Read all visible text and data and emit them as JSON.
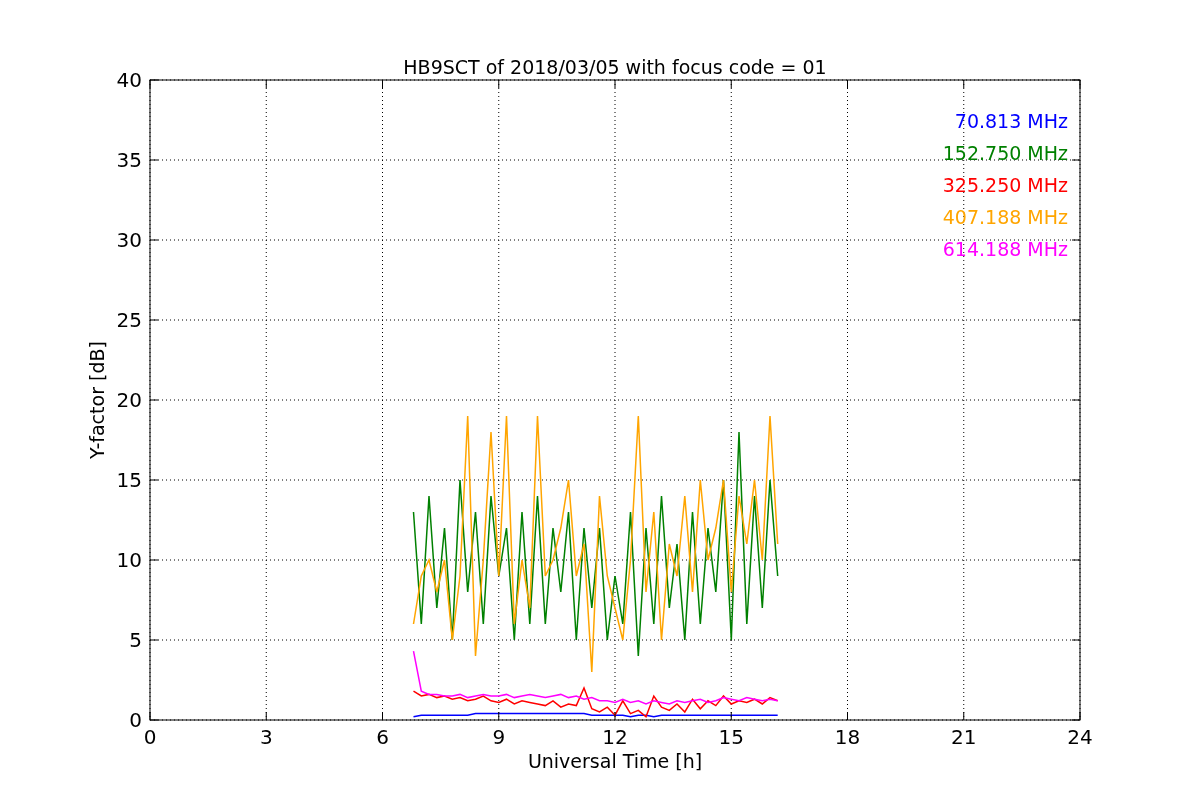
{
  "figure": {
    "chart_data": {
      "type": "line",
      "title": "HB9SCT of 2018/03/05 with focus code = 01",
      "xlabel": "Universal Time [h]",
      "ylabel": "Y-factor [dB]",
      "xlim": [
        0,
        24
      ],
      "ylim": [
        0,
        40
      ],
      "xticks": [
        0,
        3,
        6,
        9,
        12,
        15,
        18,
        21,
        24
      ],
      "yticks": [
        0,
        5,
        10,
        15,
        20,
        25,
        30,
        35,
        40
      ],
      "grid": true,
      "x": [
        6.8,
        7.0,
        7.2,
        7.4,
        7.6,
        7.8,
        8.0,
        8.2,
        8.4,
        8.6,
        8.8,
        9.0,
        9.2,
        9.4,
        9.6,
        9.8,
        10.0,
        10.2,
        10.4,
        10.6,
        10.8,
        11.0,
        11.2,
        11.4,
        11.6,
        11.8,
        12.0,
        12.2,
        12.4,
        12.6,
        12.8,
        13.0,
        13.2,
        13.4,
        13.6,
        13.8,
        14.0,
        14.2,
        14.4,
        14.6,
        14.8,
        15.0,
        15.2,
        15.4,
        15.6,
        15.8,
        16.0,
        16.2
      ],
      "series": [
        {
          "name": "70.813 MHz",
          "color": "#0000ff",
          "values": [
            0.2,
            0.3,
            0.3,
            0.3,
            0.3,
            0.3,
            0.3,
            0.3,
            0.4,
            0.4,
            0.4,
            0.4,
            0.4,
            0.4,
            0.4,
            0.4,
            0.4,
            0.4,
            0.4,
            0.4,
            0.4,
            0.4,
            0.4,
            0.3,
            0.3,
            0.3,
            0.3,
            0.3,
            0.2,
            0.3,
            0.3,
            0.2,
            0.3,
            0.3,
            0.3,
            0.3,
            0.3,
            0.3,
            0.3,
            0.3,
            0.3,
            0.3,
            0.3,
            0.3,
            0.3,
            0.3,
            0.3,
            0.3
          ]
        },
        {
          "name": "152.750 MHz",
          "color": "#008000",
          "values": [
            13,
            6,
            14,
            7,
            12,
            5,
            15,
            8,
            13,
            6,
            14,
            9,
            12,
            5,
            13,
            6,
            14,
            6,
            12,
            8,
            13,
            5,
            12,
            7,
            12,
            5,
            9,
            6,
            13,
            4,
            12,
            6,
            14,
            7,
            11,
            5,
            13,
            6,
            12,
            8,
            15,
            5,
            18,
            6,
            14,
            7,
            15,
            9
          ]
        },
        {
          "name": "325.250 MHz",
          "color": "#ff0000",
          "values": [
            1.8,
            1.5,
            1.6,
            1.4,
            1.5,
            1.3,
            1.4,
            1.2,
            1.3,
            1.5,
            1.2,
            1.1,
            1.3,
            1.0,
            1.2,
            1.1,
            1.0,
            0.9,
            1.2,
            0.8,
            1.0,
            0.9,
            2.0,
            0.7,
            0.5,
            0.8,
            0.3,
            1.2,
            0.4,
            0.6,
            0.2,
            1.5,
            0.8,
            0.6,
            1.0,
            0.5,
            1.3,
            0.7,
            1.2,
            0.9,
            1.5,
            1.0,
            1.2,
            1.1,
            1.3,
            1.0,
            1.4,
            1.2
          ]
        },
        {
          "name": "407.188 MHz",
          "color": "#ffa500",
          "values": [
            6,
            9,
            10,
            8,
            10,
            5,
            9,
            19,
            4,
            10,
            18,
            9,
            19,
            6,
            10,
            7,
            19,
            9,
            10,
            12,
            15,
            9,
            11,
            3,
            14,
            9,
            7,
            5,
            10,
            19,
            8,
            13,
            5,
            11,
            9,
            14,
            8,
            15,
            10,
            12,
            15,
            8,
            14,
            11,
            15,
            10,
            19,
            11
          ]
        },
        {
          "name": "614.188 MHz",
          "color": "#ff00ff",
          "values": [
            4.3,
            1.8,
            1.6,
            1.6,
            1.5,
            1.5,
            1.6,
            1.4,
            1.5,
            1.6,
            1.5,
            1.5,
            1.6,
            1.4,
            1.5,
            1.6,
            1.5,
            1.4,
            1.5,
            1.6,
            1.4,
            1.5,
            1.3,
            1.4,
            1.2,
            1.2,
            1.1,
            1.3,
            1.1,
            1.2,
            1.0,
            1.2,
            1.1,
            1.0,
            1.2,
            1.1,
            1.2,
            1.3,
            1.1,
            1.2,
            1.4,
            1.3,
            1.2,
            1.4,
            1.3,
            1.2,
            1.3,
            1.2
          ]
        }
      ]
    }
  }
}
